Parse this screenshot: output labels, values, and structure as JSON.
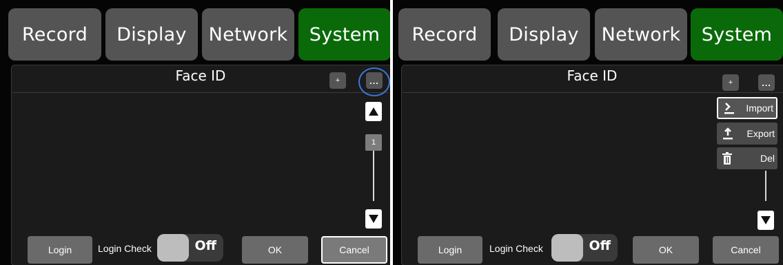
{
  "tabs": [
    "Record",
    "Display",
    "Network",
    "System"
  ],
  "active_tab": "System",
  "screen_title": "Face ID",
  "add_button": "+",
  "more_button": "...",
  "page_number": "1",
  "menu": {
    "import": "Import",
    "export": "Export",
    "delete": "Del"
  },
  "bottom": {
    "login": "Login",
    "login_check": "Login Check",
    "toggle_state": "Off",
    "ok": "OK",
    "cancel": "Cancel"
  },
  "colors": {
    "active_tab": "#0a6a0a",
    "tab": "#545454",
    "focus_ring": "#3a76d8"
  },
  "icons": {
    "up": "triangle-up-icon",
    "down": "triangle-down-icon",
    "import": "import-icon",
    "export": "export-icon",
    "delete": "trash-icon"
  }
}
